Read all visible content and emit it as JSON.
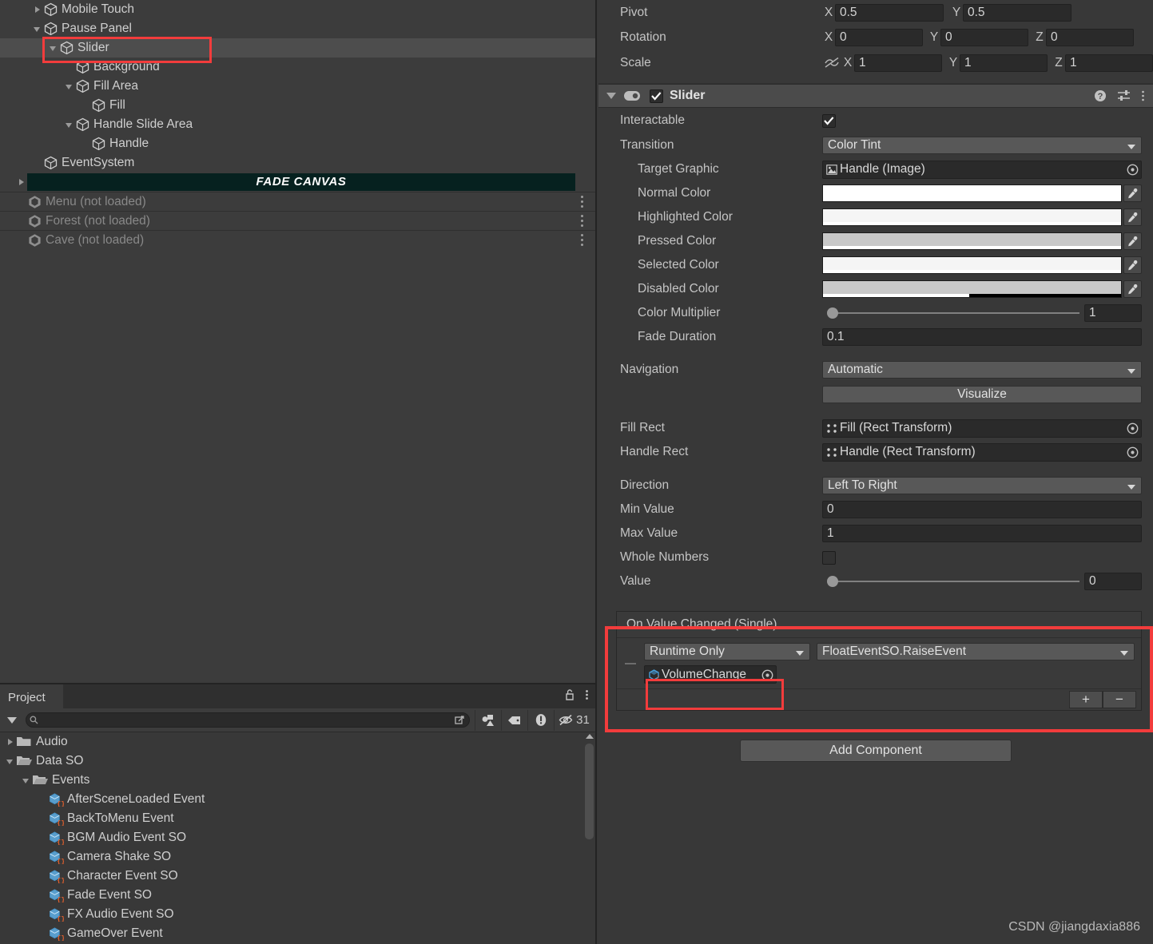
{
  "hierarchy": {
    "rows": [
      {
        "label": "Mobile Touch",
        "indent": 2,
        "twisty": "closed",
        "icon": "cube-icon",
        "state": "normal"
      },
      {
        "label": "Pause Panel",
        "indent": 2,
        "twisty": "open",
        "icon": "cube-icon",
        "state": "normal"
      },
      {
        "label": "Slider",
        "indent": 3,
        "twisty": "open",
        "icon": "cube-icon",
        "state": "selected"
      },
      {
        "label": "Background",
        "indent": 4,
        "twisty": "none",
        "icon": "cube-icon",
        "state": "normal"
      },
      {
        "label": "Fill Area",
        "indent": 4,
        "twisty": "open",
        "icon": "cube-icon",
        "state": "normal"
      },
      {
        "label": "Fill",
        "indent": 5,
        "twisty": "none",
        "icon": "cube-icon",
        "state": "normal"
      },
      {
        "label": "Handle Slide Area",
        "indent": 4,
        "twisty": "open",
        "icon": "cube-icon",
        "state": "normal"
      },
      {
        "label": "Handle",
        "indent": 5,
        "twisty": "none",
        "icon": "cube-icon",
        "state": "normal"
      },
      {
        "label": "EventSystem",
        "indent": 2,
        "twisty": "none",
        "icon": "cube-icon",
        "state": "normal"
      },
      {
        "label": "FADE CANVAS",
        "indent": 1,
        "twisty": "closed",
        "icon": "none",
        "state": "banner"
      },
      {
        "label": "Menu (not loaded)",
        "indent": 1,
        "twisty": "none",
        "icon": "unity-icon",
        "state": "notloaded"
      },
      {
        "label": "Forest (not loaded)",
        "indent": 1,
        "twisty": "none",
        "icon": "unity-icon",
        "state": "notloaded"
      },
      {
        "label": "Cave (not loaded)",
        "indent": 1,
        "twisty": "none",
        "icon": "unity-icon",
        "state": "notloaded"
      }
    ],
    "highlight_color": "#f23c3c"
  },
  "project": {
    "tab_label": "Project",
    "lock_icon": "lock-open-icon",
    "menu_icon": "kebab-menu-icon",
    "dropdown_icon": "chevron-down-icon",
    "search": {
      "value": "",
      "placeholder": "",
      "icon": "search-icon"
    },
    "toolbar_buttons": [
      {
        "name": "search-in-project-icon",
        "label": ""
      },
      {
        "name": "type-filter-icon",
        "label": ""
      },
      {
        "name": "label-filter-icon",
        "label": ""
      },
      {
        "name": "error-filter-icon",
        "label": ""
      },
      {
        "name": "hidden-items-icon",
        "label": "31"
      }
    ],
    "assets": [
      {
        "label": "Audio",
        "indent": 1,
        "twisty": "closed",
        "icon": "folder-icon"
      },
      {
        "label": "Data SO",
        "indent": 1,
        "twisty": "open",
        "icon": "folder-open-icon"
      },
      {
        "label": "Events",
        "indent": 2,
        "twisty": "open",
        "icon": "folder-open-icon"
      },
      {
        "label": "AfterSceneLoaded Event",
        "indent": 3,
        "twisty": "none",
        "icon": "scriptable-object-icon"
      },
      {
        "label": "BackToMenu Event",
        "indent": 3,
        "twisty": "none",
        "icon": "scriptable-object-icon"
      },
      {
        "label": "BGM Audio Event SO",
        "indent": 3,
        "twisty": "none",
        "icon": "scriptable-object-icon"
      },
      {
        "label": "Camera Shake SO",
        "indent": 3,
        "twisty": "none",
        "icon": "scriptable-object-icon"
      },
      {
        "label": "Character Event SO",
        "indent": 3,
        "twisty": "none",
        "icon": "scriptable-object-icon"
      },
      {
        "label": "Fade Event SO",
        "indent": 3,
        "twisty": "none",
        "icon": "scriptable-object-icon"
      },
      {
        "label": "FX Audio Event SO",
        "indent": 3,
        "twisty": "none",
        "icon": "scriptable-object-icon"
      },
      {
        "label": "GameOver Event",
        "indent": 3,
        "twisty": "none",
        "icon": "scriptable-object-icon"
      }
    ]
  },
  "inspector": {
    "transform": {
      "pivot": {
        "label": "Pivot",
        "x_axis": "X",
        "x": "0.5",
        "y_axis": "Y",
        "y": "0.5"
      },
      "rotation": {
        "label": "Rotation",
        "x_axis": "X",
        "x": "0",
        "y_axis": "Y",
        "y": "0",
        "z_axis": "Z",
        "z": "0"
      },
      "scale": {
        "label": "Scale",
        "x_axis": "X",
        "x": "1",
        "y_axis": "Y",
        "y": "1",
        "z_axis": "Z",
        "z": "1",
        "link_icon": "scale-link-off-icon"
      }
    },
    "component": {
      "title": "Slider",
      "foldout_icon": "chevron-down-icon",
      "toggle_icon": "component-toggle-icon",
      "enabled": true,
      "help_icon": "help-icon",
      "preset_icon": "preset-icon",
      "menu_icon": "kebab-menu-icon",
      "interactable": {
        "label": "Interactable",
        "checked": true
      },
      "transition": {
        "label": "Transition",
        "value": "Color Tint"
      },
      "target_graphic": {
        "label": "Target Graphic",
        "value": "Handle (Image)",
        "icon": "image-component-icon"
      },
      "colors": [
        {
          "label": "Normal Color",
          "color": "#ffffff",
          "alpha_pct": 100
        },
        {
          "label": "Highlighted Color",
          "color": "#f5f5f5",
          "alpha_pct": 100
        },
        {
          "label": "Pressed Color",
          "color": "#c8c8c8",
          "alpha_pct": 100
        },
        {
          "label": "Selected Color",
          "color": "#f5f5f5",
          "alpha_pct": 100
        },
        {
          "label": "Disabled Color",
          "color": "#c8c8c8",
          "alpha_pct": 49
        }
      ],
      "color_multiplier": {
        "label": "Color Multiplier",
        "value": "1",
        "slider_pct": 0
      },
      "fade_duration": {
        "label": "Fade Duration",
        "value": "0.1"
      },
      "navigation": {
        "label": "Navigation",
        "value": "Automatic"
      },
      "visualize_button": "Visualize",
      "fill_rect": {
        "label": "Fill Rect",
        "value": "Fill (Rect Transform)",
        "icon": "rect-transform-icon"
      },
      "handle_rect": {
        "label": "Handle Rect",
        "value": "Handle (Rect Transform)",
        "icon": "rect-transform-icon"
      },
      "direction": {
        "label": "Direction",
        "value": "Left To Right"
      },
      "min_value": {
        "label": "Min Value",
        "value": "0"
      },
      "max_value": {
        "label": "Max Value",
        "value": "1"
      },
      "whole_numbers": {
        "label": "Whole Numbers",
        "checked": false
      },
      "value": {
        "label": "Value",
        "value": "0",
        "slider_pct": 0
      }
    },
    "on_value_changed": {
      "title": "On Value Changed (Single)",
      "entries": [
        {
          "mode": "Runtime Only",
          "function": "FloatEventSO.RaiseEvent",
          "object": "VolumeChange",
          "object_icon": "scriptable-object-icon",
          "drag_handle_icon": "drag-handle-icon"
        }
      ],
      "add_button": "+",
      "remove_button": "−"
    },
    "add_component_button": "Add Component"
  },
  "watermark": "CSDN @jiangdaxia886",
  "colors": {
    "panel_bg": "#383838",
    "hierarchy_bg": "#3c3c3c",
    "field_bg": "#2a2a2a",
    "dropdown_bg": "#585858",
    "header_bg": "#4b4b4b",
    "selection": "#4d4d4d",
    "highlight_red": "#f23c3c",
    "fade_canvas_bg": "#06211f"
  }
}
